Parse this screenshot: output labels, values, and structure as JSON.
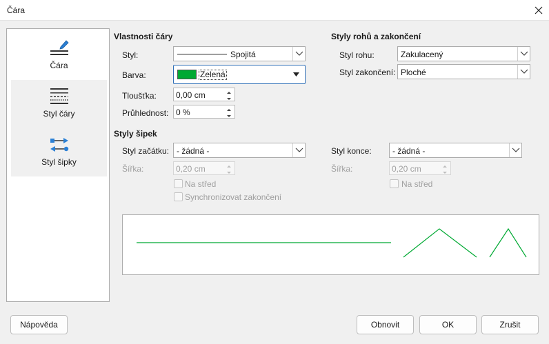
{
  "window": {
    "title": "Čára"
  },
  "sidebar": {
    "items": [
      {
        "label": "Čára"
      },
      {
        "label": "Styl čáry"
      },
      {
        "label": "Styl šipky"
      }
    ]
  },
  "line_props": {
    "heading": "Vlastnosti čáry",
    "style_label": "Styl:",
    "style_value": "Spojitá",
    "color_label": "Barva:",
    "color_value": "Zelená",
    "color_hex": "#00a933",
    "width_label": "Tloušťka:",
    "width_value": "0,00 cm",
    "transparency_label": "Průhlednost:",
    "transparency_value": "0 %"
  },
  "corners": {
    "heading": "Styly rohů a zakončení",
    "corner_label": "Styl rohu:",
    "corner_value": "Zakulacený",
    "cap_label": "Styl zakončení:",
    "cap_value": "Ploché"
  },
  "arrows": {
    "heading": "Styly šipek",
    "start_label": "Styl začátku:",
    "start_value": "- žádná -",
    "end_label": "Styl konce:",
    "end_value": "- žádná -",
    "start_width_label": "Šířka:",
    "start_width_value": "0,20 cm",
    "end_width_label": "Šířka:",
    "end_width_value": "0,20 cm",
    "start_center_label": "Na střed",
    "end_center_label": "Na střed",
    "sync_label": "Synchronizovat zakončení"
  },
  "buttons": {
    "help": "Nápověda",
    "reset": "Obnovit",
    "ok": "OK",
    "cancel": "Zrušit"
  }
}
